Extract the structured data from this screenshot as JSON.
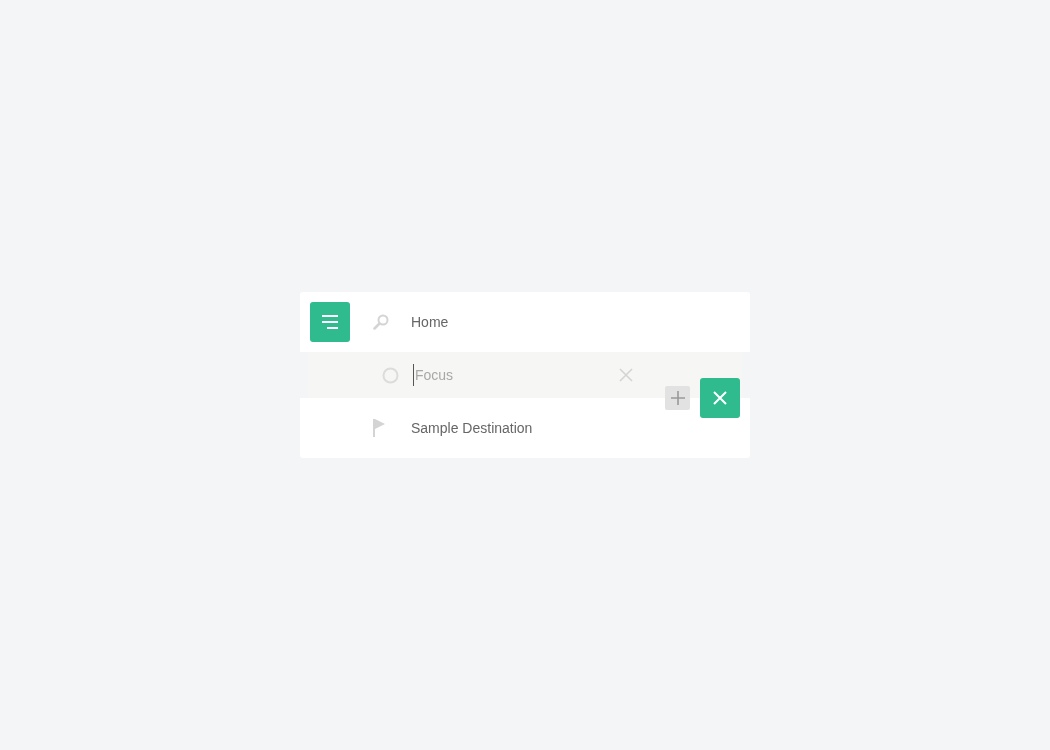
{
  "origin": {
    "value": "Home"
  },
  "waypoint": {
    "placeholder": "Focus"
  },
  "destination": {
    "value": "Sample Destination"
  }
}
